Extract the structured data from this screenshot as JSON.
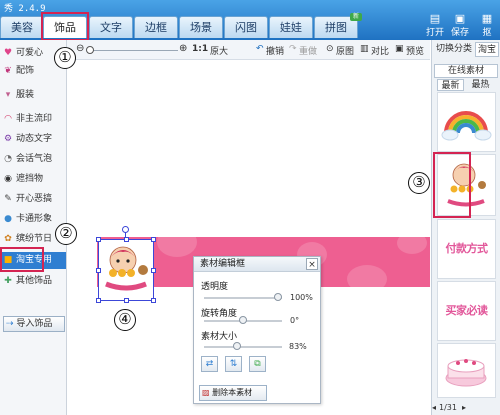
{
  "app": {
    "title": "秀 2.4.9"
  },
  "tabs": [
    {
      "label": "美容"
    },
    {
      "label": "饰品"
    },
    {
      "label": "文字"
    },
    {
      "label": "边框"
    },
    {
      "label": "场景"
    },
    {
      "label": "闪图"
    },
    {
      "label": "娃娃"
    },
    {
      "label": "拼图",
      "badge": "新"
    }
  ],
  "top_actions": [
    {
      "label": "打开",
      "icon": "folder-icon"
    },
    {
      "label": "保存",
      "icon": "save-icon"
    },
    {
      "label": "抠",
      "icon": "cut-icon"
    }
  ],
  "toolbar": {
    "zoom_ratio": "1:1",
    "zoom_max": "原大",
    "undo": "撤销",
    "redo": "重做",
    "original": "原图",
    "compare": "对比",
    "preview": "预览"
  },
  "categories": [
    {
      "label": "可爱心",
      "icon": "heart-icon",
      "color": "#e0458a"
    },
    {
      "label": "配饰",
      "icon": "bow-icon",
      "color": "#c0357a"
    },
    {
      "label": "服装",
      "icon": "clothes-icon",
      "color": "#c06090"
    },
    {
      "label": "非主流印",
      "icon": "lips-icon",
      "color": "#d03060"
    },
    {
      "label": "动态文字",
      "icon": "text-icon",
      "color": "#7a3aa8"
    },
    {
      "label": "会话气泡",
      "icon": "bubble-icon",
      "color": "#666666"
    },
    {
      "label": "遮挡物",
      "icon": "mask-icon",
      "color": "#333333"
    },
    {
      "label": "开心恶搞",
      "icon": "fun-icon",
      "color": "#444444"
    },
    {
      "label": "卡通形象",
      "icon": "cartoon-icon",
      "color": "#3a8ad0"
    },
    {
      "label": "缤纷节日",
      "icon": "gift-icon",
      "color": "#d08020"
    },
    {
      "label": "淘宝专用",
      "icon": "taobao-icon",
      "color": "#e66a00",
      "selected": true
    },
    {
      "label": "其他饰品",
      "icon": "other-icon",
      "color": "#44a060"
    }
  ],
  "import_button": "导入饰品",
  "editor": {
    "title": "素材编辑框",
    "close_glyph": "×",
    "opacity_label": "透明度",
    "opacity_value": "100%",
    "opacity_fraction": 1.0,
    "rotation_label": "旋转角度",
    "rotation_value": "0°",
    "rotation_fraction": 0.5,
    "size_label": "素材大小",
    "size_value": "83%",
    "size_fraction": 0.42,
    "delete_label": "删除本素材"
  },
  "right_panel": {
    "tabs": [
      "切换分类",
      "淘宝"
    ],
    "online_label": "在线素材",
    "sort_tabs": [
      "最新",
      "最热"
    ],
    "thumbs": [
      {
        "name": "rainbow"
      },
      {
        "name": "girl-sticker"
      },
      {
        "name": "payment",
        "text": "付款方式"
      },
      {
        "name": "buyer",
        "text": "买家必读"
      },
      {
        "name": "cake"
      }
    ],
    "pagination": "1/31"
  },
  "markers": [
    "①",
    "②",
    "③",
    "④"
  ],
  "colors": {
    "accent": "#2f7ed1",
    "highlight": "#d42452",
    "banner": "#ee5f91"
  }
}
